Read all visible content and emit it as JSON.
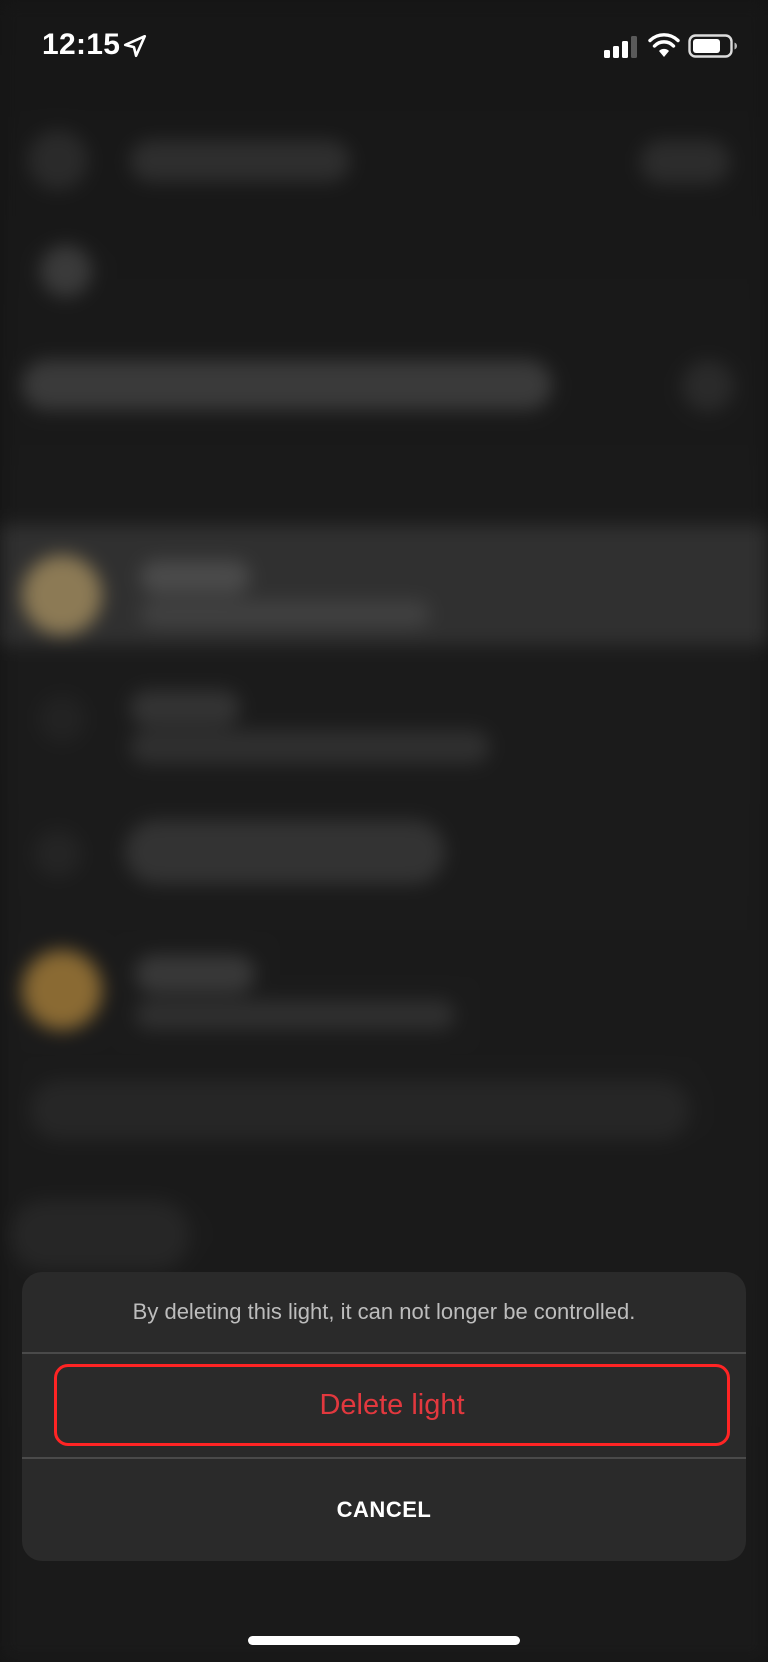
{
  "status_bar": {
    "time": "12:15",
    "icons": [
      "location-arrow-icon",
      "cellular-signal-icon",
      "wifi-icon",
      "battery-icon"
    ]
  },
  "action_sheet": {
    "message": "By deleting this light, it can not longer be controlled.",
    "delete_label": "Delete light",
    "cancel_label": "CANCEL"
  },
  "colors": {
    "sheet_background": "#2a2a2a",
    "delete_text": "#e2383e",
    "highlight_border": "#ff2424",
    "message_text": "#bdbdbd"
  }
}
